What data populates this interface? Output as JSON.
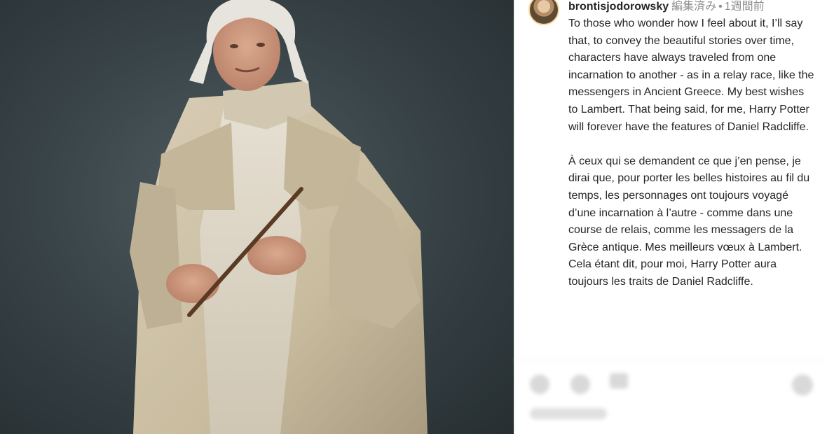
{
  "post": {
    "username": "brontisjodorowsky",
    "edited": "編集済み",
    "separator": "•",
    "time": "1週間前",
    "caption_en": "To those who wonder how I feel about it, I’ll say that, to convey the beautiful stories over time, characters have always traveled from one incarnation to another - as in a relay race, like the messengers in Ancient Greece. My best wishes to Lambert. That being said, for me, Harry Potter will forever have the features of Daniel Radcliffe.",
    "caption_fr": "À ceux qui se demandent ce que j’en pense, je dirai que, pour porter les belles histoires au fil du temps, les personnages ont toujours voyagé d’une incarnation à l’autre - comme dans une course de relais, comme les messagers de la Grèce antique. Mes meilleurs vœux à Lambert. Cela étant dit, pour moi, Harry Potter aura toujours les traits de Daniel Radcliffe."
  },
  "icons": {
    "like": "heart-icon",
    "comment": "comment-icon",
    "share": "share-icon",
    "save": "bookmark-icon"
  }
}
